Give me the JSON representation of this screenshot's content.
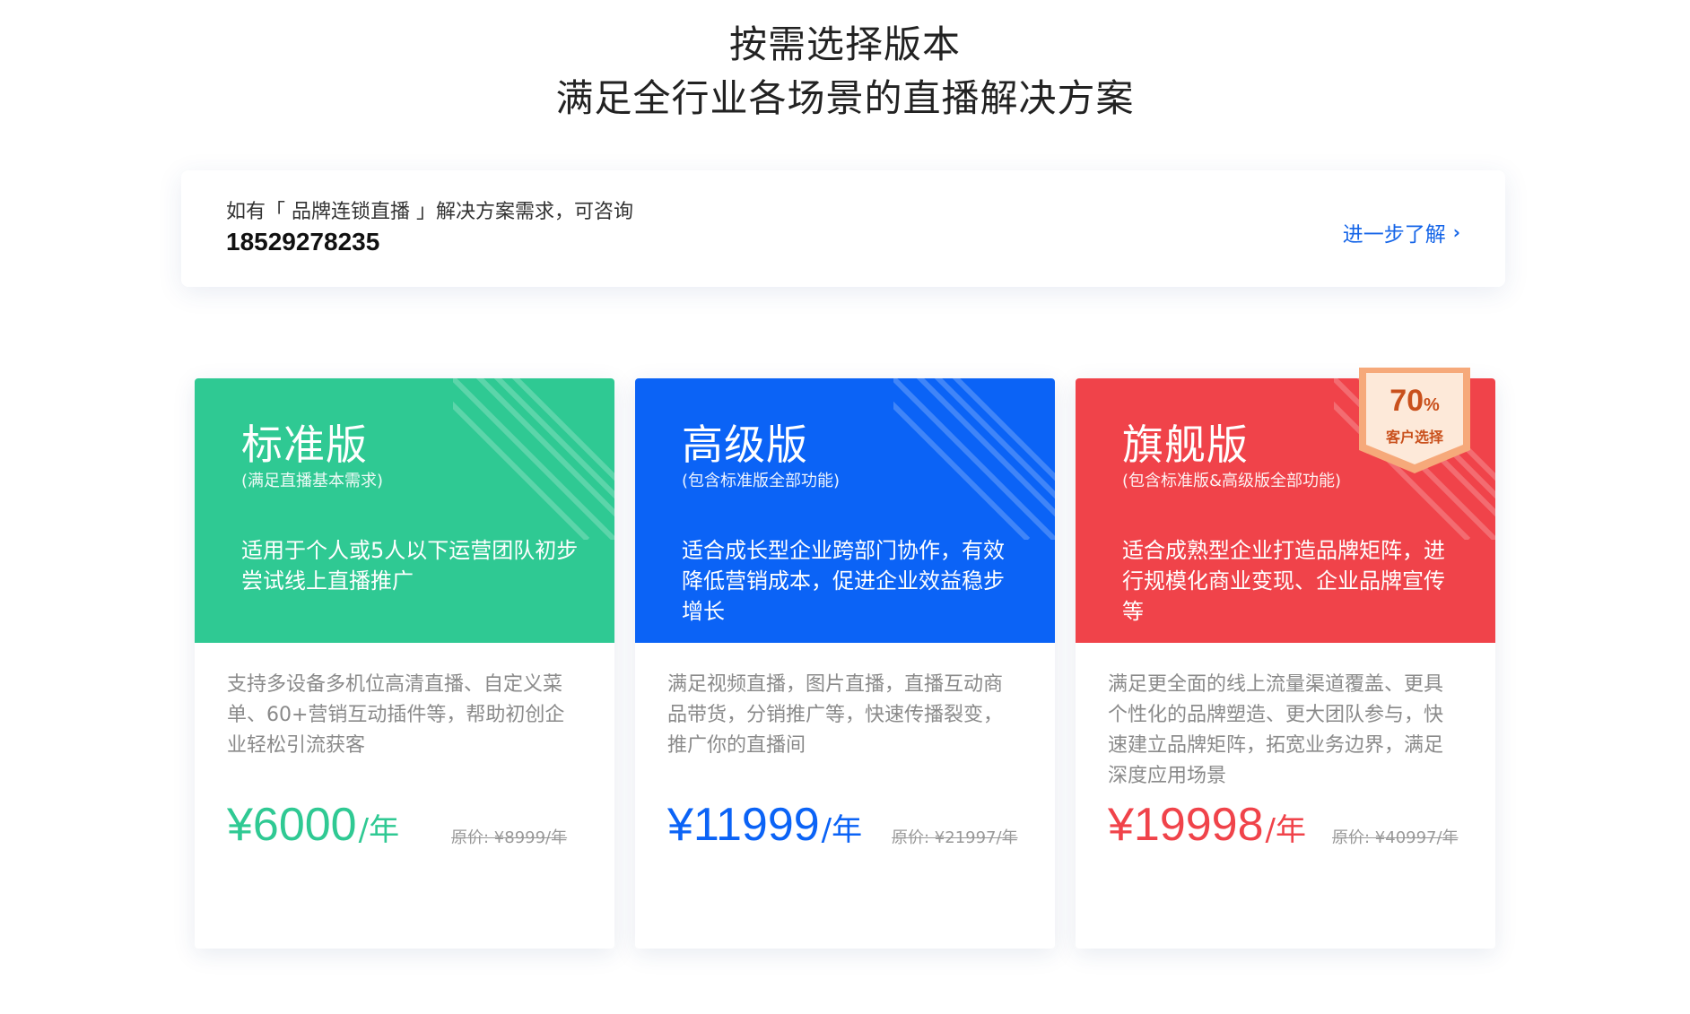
{
  "heading": {
    "line1": "按需选择版本",
    "line2": "满足全行业各场景的直播解决方案"
  },
  "consult": {
    "text": "如有「 品牌连锁直播 」解决方案需求，可咨询",
    "phone": "18529278235",
    "link_label": "进一步了解",
    "link_icon": "chevron-right-icon"
  },
  "plans": [
    {
      "name": "标准版",
      "subtitle": "(满足直播基本需求)",
      "summary": "适用于个人或5人以下运营团队初步尝试线上直播推广",
      "description": "支持多设备多机位高清直播、自定义菜单、60+营销互动插件等，帮助初创企业轻松引流获客",
      "price": "¥6000",
      "unit": "/年",
      "original_price": "原价: ¥8999/年",
      "color": "#2fc993"
    },
    {
      "name": "高级版",
      "subtitle": "(包含标准版全部功能)",
      "summary": "适合成长型企业跨部门协作，有效降低营销成本，促进企业效益稳步增长",
      "description": "满足视频直播，图片直播，直播互动商品带货，分销推广等，快速传播裂变，推广你的直播间",
      "price": "¥11999",
      "unit": "/年",
      "original_price": "原价: ¥21997/年",
      "color": "#0b63f6"
    },
    {
      "name": "旗舰版",
      "subtitle": "(包含标准版&高级版全部功能)",
      "summary": "适合成熟型企业打造品牌矩阵，进行规模化商业变现、企业品牌宣传等",
      "description": "满足更全面的线上流量渠道覆盖、更具个性化的品牌塑造、更大团队参与，快速建立品牌矩阵，拓宽业务边界，满足深度应用场景",
      "price": "¥19998",
      "unit": "/年",
      "original_price": "原价: ¥40997/年",
      "color": "#f0434a",
      "badge": {
        "value": "70",
        "suffix": "%",
        "label": "客户选择"
      }
    }
  ]
}
